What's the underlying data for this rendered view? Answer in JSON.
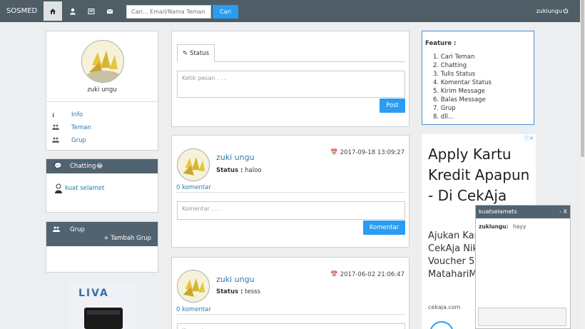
{
  "navbar": {
    "brand": "SOSMED",
    "search_placeholder": "Cari... Email/Nama Teman",
    "search_button": "Cari",
    "username": "zukiungu"
  },
  "profile": {
    "name": "zuki ungu",
    "links": [
      {
        "label": "Info",
        "icon": "info-icon"
      },
      {
        "label": "Teman",
        "icon": "users-icon"
      },
      {
        "label": "Grup",
        "icon": "users-icon"
      }
    ]
  },
  "chatting": {
    "title": "Chatting",
    "emoji": "😂",
    "contacts": [
      "kuat selamet"
    ]
  },
  "grup": {
    "title": "Grup",
    "add_label": "+ Tambah Grup"
  },
  "status_form": {
    "tab_label": "Status",
    "placeholder": "Ketik pesan . . .",
    "post_button": "Post"
  },
  "posts": [
    {
      "author": "zuki ungu",
      "date": "2017-09-18 13:09:27",
      "status_label": "Status :",
      "status_text": "haloo",
      "comments": "0 komentar",
      "comment_placeholder": "Komentar . . .",
      "comment_button": "Komentar"
    },
    {
      "author": "zuki ungu",
      "date": "2017-06-02 21:06:47",
      "status_label": "Status :",
      "status_text": "tesss",
      "comments": "0 komentar",
      "comment_placeholder": "Komentar . . ."
    }
  ],
  "features": {
    "title": "Feature :",
    "items": [
      "1. Cari Teman",
      "2. Chatting",
      "3. Tulis Status",
      "4. Komentar Status",
      "5. Kirim Message",
      "6. Balas Message",
      "7. Grup",
      "8. dll..."
    ]
  },
  "ad": {
    "headline": "Apply Kartu Kredit Apapun - Di CekAja",
    "body": "Ajukan Kartu Di CekAja Nikmati Gratis Voucher 5 MatahariMall",
    "url": "cekaja.com"
  },
  "chat_window": {
    "title": "kuatselamets",
    "close": "- X",
    "sender": "zukiungu:",
    "message": "hayy"
  },
  "colors": {
    "navbar": "#4e5d66",
    "panel_header": "#516370",
    "accent": "#2a9cf2",
    "link": "#2a7ab0",
    "background": "#eceeef"
  }
}
